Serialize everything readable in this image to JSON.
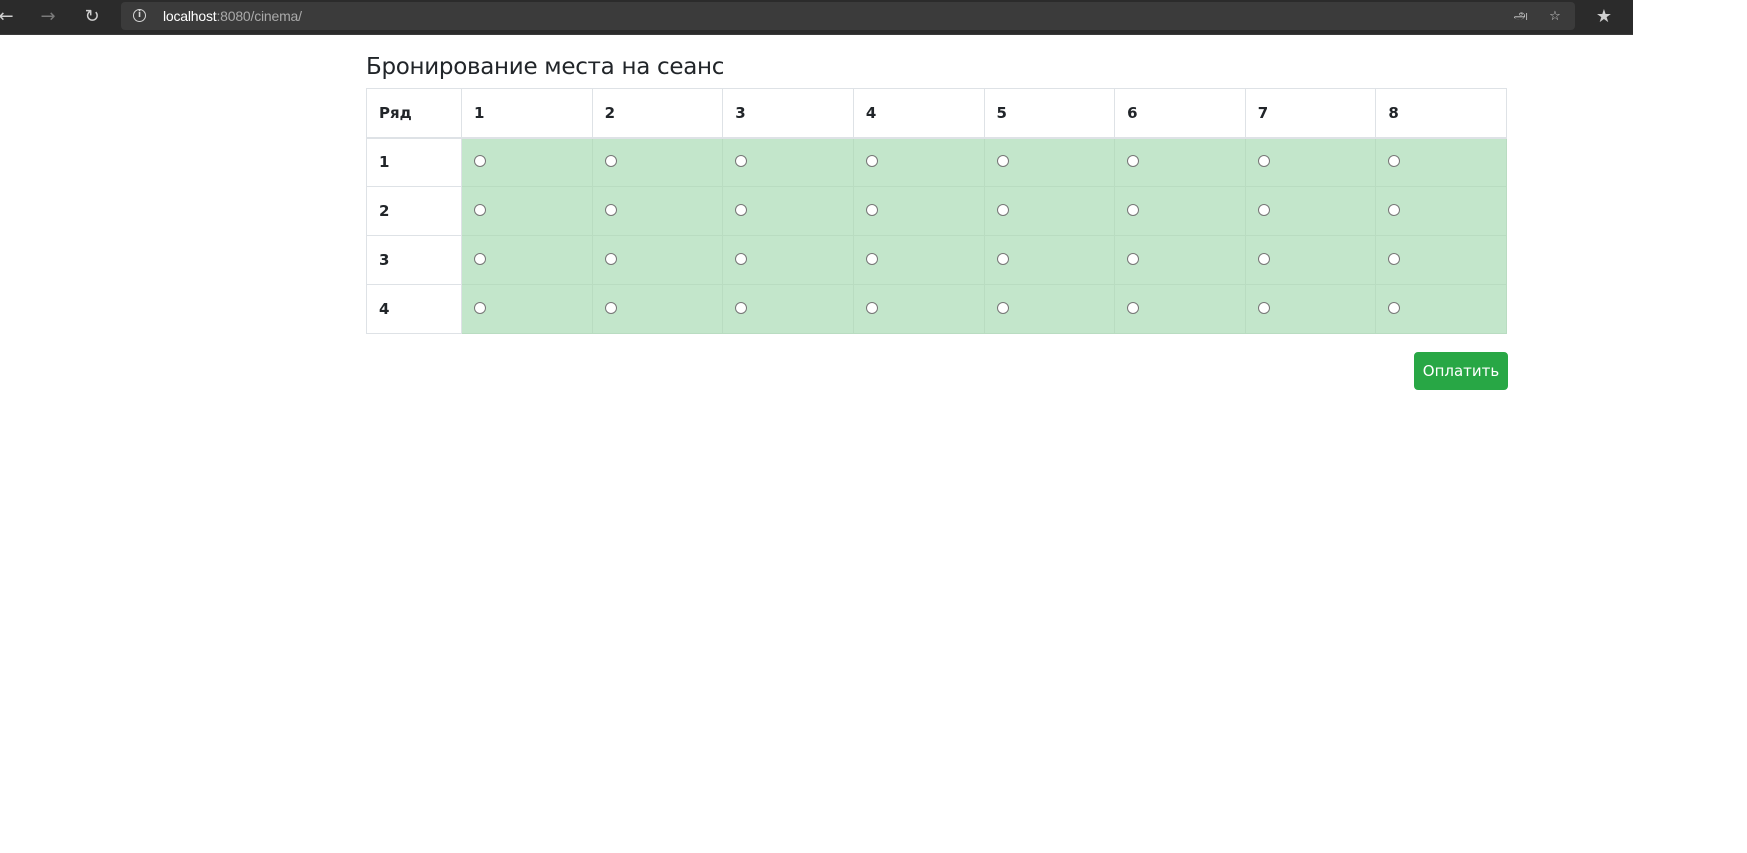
{
  "browser": {
    "url_host": "localhost",
    "url_path": ":8080/cinema/",
    "back_icon": "arrow-left-icon",
    "forward_icon": "arrow-right-icon",
    "reload_icon": "reload-icon",
    "info_icon": "info-icon",
    "translate_icon": "translate-icon",
    "add_favorite_icon": "star-add-icon",
    "favorites_icon": "favorites-icon"
  },
  "page": {
    "title": "Бронирование места на сеанс"
  },
  "table": {
    "row_header": "Ряд",
    "columns": [
      "1",
      "2",
      "3",
      "4",
      "5",
      "6",
      "7",
      "8"
    ],
    "rows": [
      "1",
      "2",
      "3",
      "4"
    ],
    "seat_color": "#c3e6cb"
  },
  "pay_button": {
    "label": "Оплатить",
    "color": "#28a745"
  }
}
